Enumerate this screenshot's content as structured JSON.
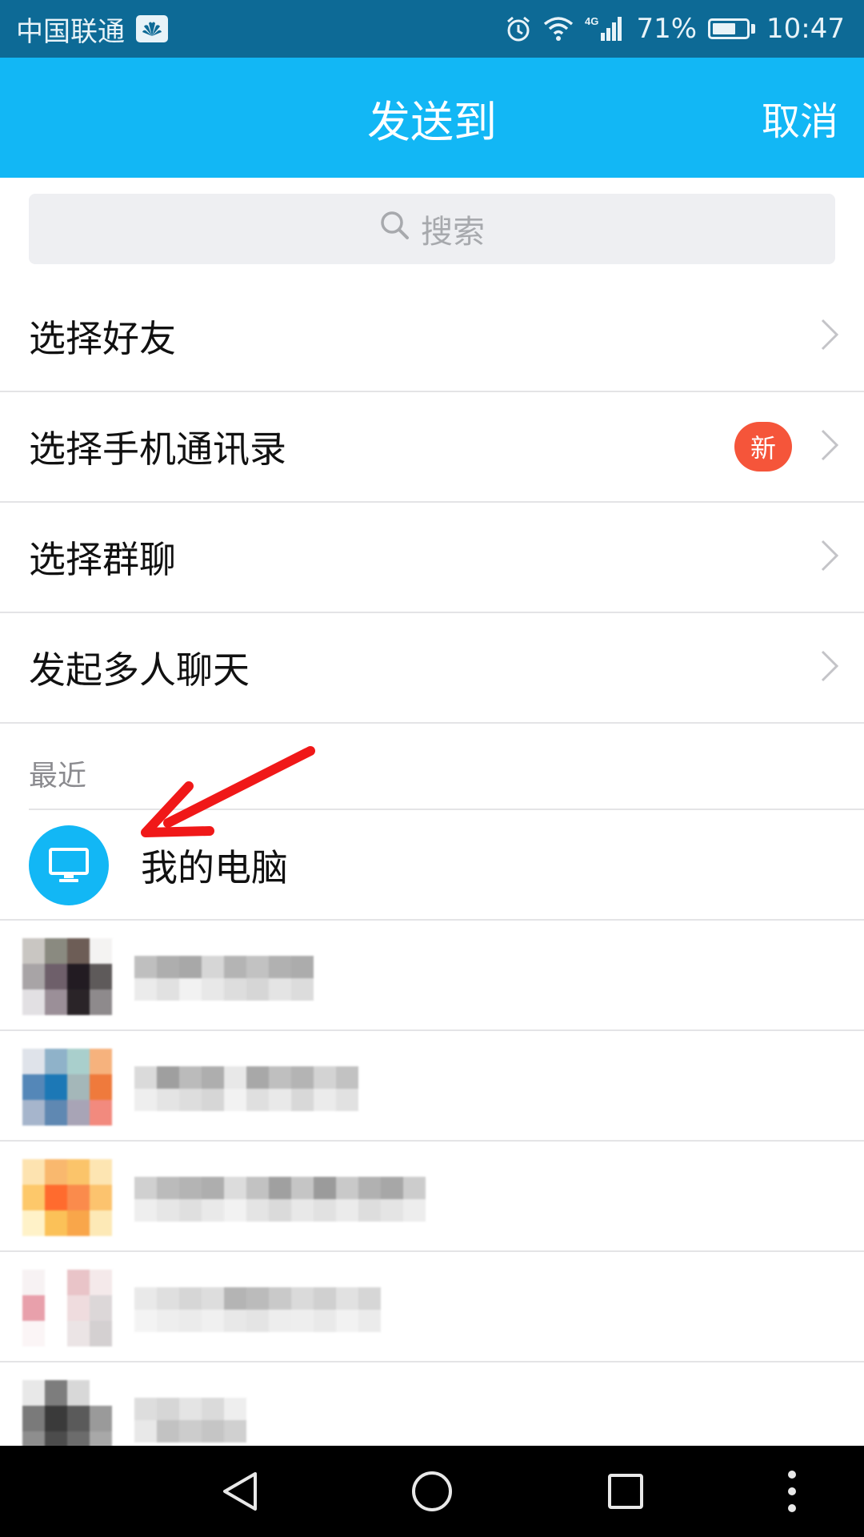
{
  "status_bar": {
    "carrier": "中国联通",
    "network": "4G",
    "battery_text": "71%",
    "battery_level": 0.71,
    "time": "10:47",
    "icons": [
      "huawei-badge-icon",
      "alarm-icon",
      "wifi-icon",
      "signal-icon",
      "battery-icon"
    ]
  },
  "header": {
    "title": "发送到",
    "cancel_label": "取消",
    "background": "#12b7f5"
  },
  "search": {
    "placeholder": "搜索",
    "icon": "search-icon"
  },
  "menu": {
    "items": [
      {
        "label": "选择好友"
      },
      {
        "label": "选择手机通讯录",
        "badge": "新"
      },
      {
        "label": "选择群聊"
      },
      {
        "label": "发起多人聊天"
      }
    ]
  },
  "recent": {
    "section_label": "最近",
    "my_computer": "我的电脑"
  },
  "colors": {
    "status_bar": "#0d6a96",
    "accent": "#12b7f5",
    "badge": "#f5553a",
    "annotation_arrow": "#f01818"
  }
}
